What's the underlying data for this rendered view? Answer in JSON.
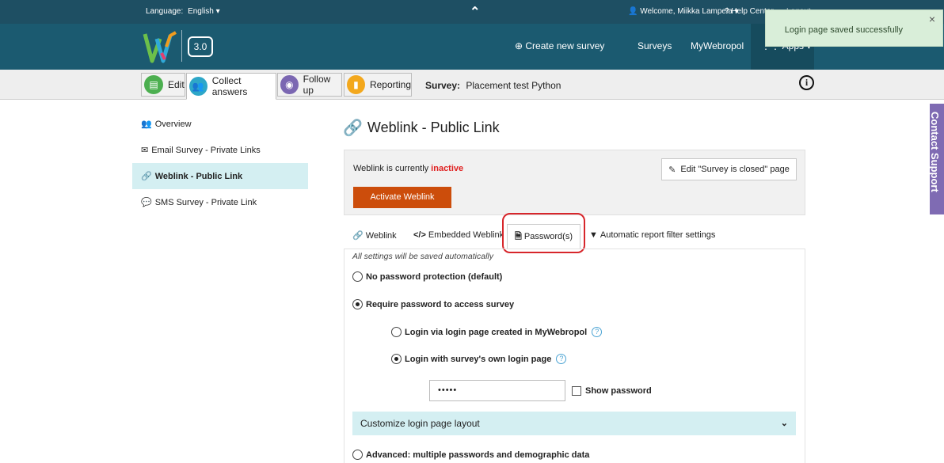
{
  "topbar": {
    "language_label": "Language:",
    "language_value": "English ▾",
    "collapse_glyph": "⌃",
    "welcome": "👤 Welcome, Miikka Lampela ▾",
    "help": "? Help Center",
    "logout": "Logout"
  },
  "header": {
    "version": "3.0",
    "create": "⊕ Create new survey",
    "surveys": "Surveys",
    "mywebropol": "MyWebropol",
    "apps": "⋮⋮ Apps ▾"
  },
  "toast": {
    "message": "Login page saved successfully",
    "close": "×"
  },
  "toolbar": {
    "edit": "Edit",
    "collect": "Collect answers",
    "follow": "Follow up",
    "reporting": "Reporting",
    "survey_label": "Survey:",
    "survey_name": "Placement test Python",
    "info_icon": "i"
  },
  "sidebar": {
    "items": [
      {
        "icon": "👥",
        "label": "Overview"
      },
      {
        "icon": "✉",
        "label": "Email Survey - Private Links"
      },
      {
        "icon": "🔗",
        "label": "Weblink - Public Link"
      },
      {
        "icon": "💬",
        "label": "SMS Survey - Private Link"
      }
    ]
  },
  "main": {
    "title": "Weblink - Public Link",
    "status_text": "Weblink is currently",
    "status_value": "inactive",
    "activate": "Activate Weblink",
    "edit_closed": "Edit \"Survey is closed\" page",
    "tabs": {
      "weblink": "Weblink",
      "embedded": "Embedded Weblink",
      "password": "Password(s)",
      "auto": "Automatic report filter settings"
    },
    "note": "All settings will be saved automatically",
    "options": {
      "no_password": "No password protection (default)",
      "require": "Require password to access survey",
      "login_mywebropol": "Login via login page created in MyWebropol",
      "login_own": "Login with survey's own login page",
      "advanced": "Advanced: multiple passwords and demographic data"
    },
    "password_value": "•••••",
    "show_password": "Show password",
    "customize": "Customize login page layout"
  },
  "contact_support": "Contact Support",
  "colors": {
    "topbar": "#1e4f63",
    "header": "#1b5a70",
    "accent_orange": "#cc4d0b",
    "inactive_red": "#e02020",
    "highlight_ring": "#d7262b",
    "contact_purple": "#7f6bb3"
  }
}
